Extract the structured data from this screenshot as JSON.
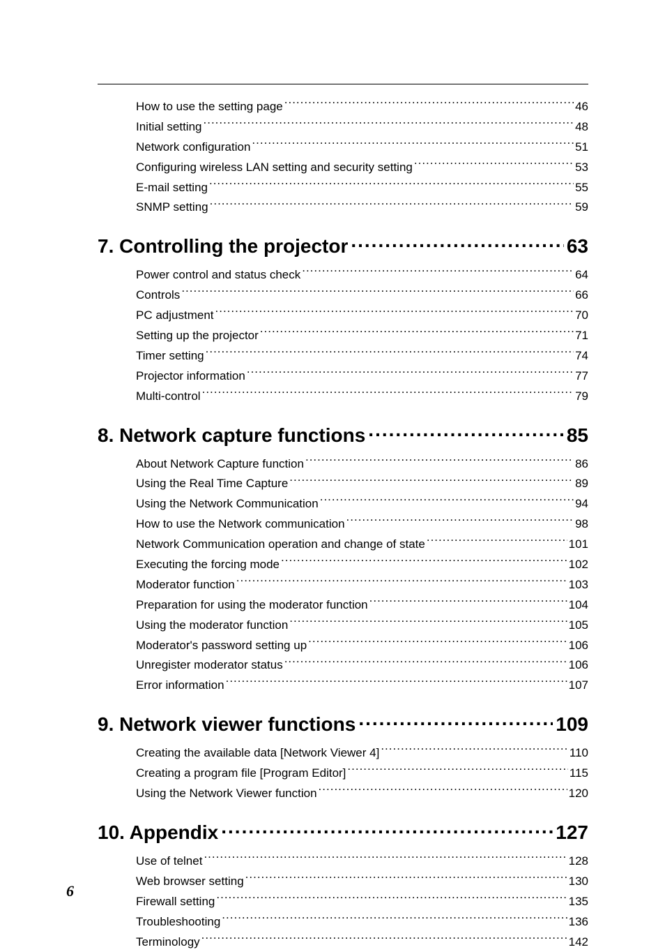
{
  "page_number": "6",
  "sections": [
    {
      "subs": [
        {
          "title": "How to use the setting page",
          "page": "46"
        },
        {
          "title": "Initial setting",
          "page": "48"
        },
        {
          "title": "Network configuration",
          "page": "51"
        },
        {
          "title": "Configuring wireless LAN setting and security setting",
          "page": "53"
        },
        {
          "title": "E-mail setting",
          "page": "55"
        },
        {
          "title": "SNMP setting",
          "page": "59"
        }
      ]
    },
    {
      "chapter": {
        "title": "7. Controlling the projector",
        "page": "63"
      },
      "subs": [
        {
          "title": "Power control and status check",
          "page": "64"
        },
        {
          "title": "Controls",
          "page": "66"
        },
        {
          "title": "PC adjustment",
          "page": "70"
        },
        {
          "title": "Setting up the projector",
          "page": "71"
        },
        {
          "title": "Timer setting",
          "page": "74"
        },
        {
          "title": "Projector information",
          "page": "77"
        },
        {
          "title": "Multi-control",
          "page": "79"
        }
      ]
    },
    {
      "chapter": {
        "title": "8. Network capture functions",
        "page": "85"
      },
      "subs": [
        {
          "title": "About Network Capture function",
          "page": "86"
        },
        {
          "title": "Using the Real Time Capture",
          "page": "89"
        },
        {
          "title": "Using the Network Communication",
          "page": "94"
        },
        {
          "title": "How to use the Network  communication",
          "page": "98"
        },
        {
          "title": "Network Communication operation and change of state",
          "page": "101"
        },
        {
          "title": "Executing the forcing mode",
          "page": "102"
        },
        {
          "title": "Moderator function",
          "page": "103"
        },
        {
          "title": "Preparation for using the moderator function",
          "page": "104"
        },
        {
          "title": "Using the moderator function",
          "page": "105"
        },
        {
          "title": "Moderator's password setting up",
          "page": "106"
        },
        {
          "title": "Unregister moderator status",
          "page": "106"
        },
        {
          "title": "Error information",
          "page": "107"
        }
      ]
    },
    {
      "chapter": {
        "title": "9.  Network viewer functions",
        "page": "109"
      },
      "subs": [
        {
          "title": "Creating the available data [Network Viewer 4]",
          "page": "110"
        },
        {
          "title": "Creating a program file [Program Editor]",
          "page": "115"
        },
        {
          "title": "Using the Network Viewer function",
          "page": "120"
        }
      ]
    },
    {
      "chapter": {
        "title": "10. Appendix",
        "page": "127"
      },
      "subs": [
        {
          "title": "Use of telnet",
          "page": "128"
        },
        {
          "title": "Web browser setting",
          "page": "130"
        },
        {
          "title": "Firewall setting",
          "page": "135"
        },
        {
          "title": "Troubleshooting",
          "page": "136"
        },
        {
          "title": "Terminology",
          "page": "142"
        }
      ]
    }
  ]
}
